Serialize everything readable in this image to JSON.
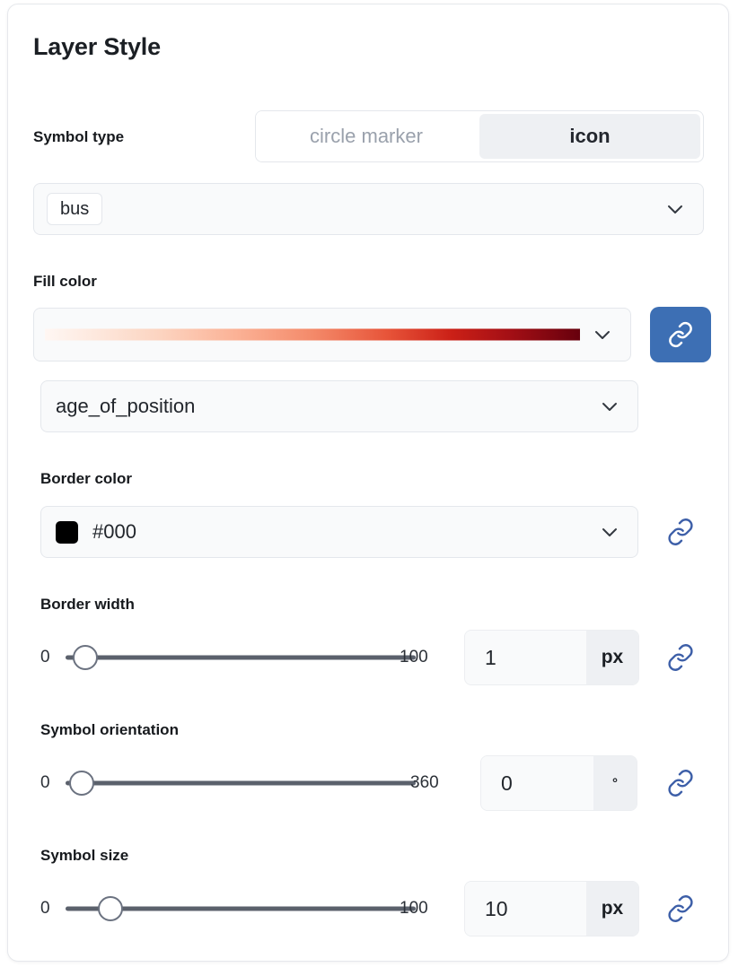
{
  "panel": {
    "title": "Layer Style"
  },
  "symbol_type": {
    "label": "Symbol type",
    "options": [
      "circle marker",
      "icon"
    ],
    "selected": "icon"
  },
  "icon_select": {
    "value": "bus",
    "chevron": "chevron-down-icon"
  },
  "fill_color": {
    "label": "Fill color",
    "gradient_name": "reds-sequential",
    "gradient_stops": [
      "#fff7f3",
      "#fcd3bf",
      "#f48a6a",
      "#cb2017",
      "#67000d"
    ],
    "chevron": "chevron-down-icon",
    "link_button": "link-icon",
    "link_button_color": "#3d6fb4",
    "attribute": "age_of_position",
    "attribute_chevron": "chevron-down-icon"
  },
  "border_color": {
    "label": "Border color",
    "swatch": "#000",
    "value": "#000",
    "chevron": "chevron-down-icon",
    "link": "link-icon"
  },
  "border_width": {
    "label": "Border width",
    "min": "0",
    "max": "100",
    "value": "1",
    "unit": "px",
    "link": "link-icon",
    "thumb_percent": 1
  },
  "symbol_orientation": {
    "label": "Symbol orientation",
    "min": "0",
    "max": "360",
    "value": "0",
    "unit": "°",
    "link": "link-icon",
    "thumb_percent": 0
  },
  "symbol_size": {
    "label": "Symbol size",
    "min": "0",
    "max": "100",
    "value": "10",
    "unit": "px",
    "link": "link-icon",
    "thumb_percent": 10
  }
}
